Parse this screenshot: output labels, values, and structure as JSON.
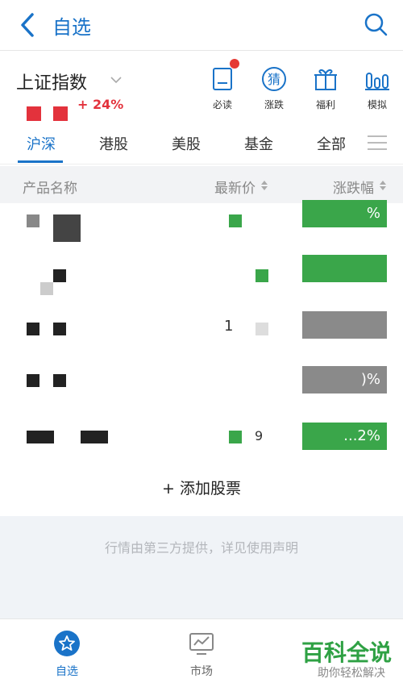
{
  "header": {
    "title": "自选"
  },
  "index": {
    "name": "上证指数",
    "change": "+  24%"
  },
  "shortcuts": [
    {
      "label": "必读",
      "icon": "doc-icon"
    },
    {
      "label": "涨跌",
      "icon": "guess-icon",
      "glyph": "猜"
    },
    {
      "label": "福利",
      "icon": "gift-icon"
    },
    {
      "label": "模拟",
      "icon": "bar-chart-icon"
    }
  ],
  "tabs": [
    "沪深",
    "港股",
    "美股",
    "基金",
    "全部"
  ],
  "columns": {
    "name": "产品名称",
    "price": "最新价",
    "change": "涨跌幅"
  },
  "rows": [
    {
      "price": "",
      "change": "%"
    },
    {
      "price": "",
      "change": ""
    },
    {
      "price": "1",
      "change": ""
    },
    {
      "price": "",
      "change": ")%"
    },
    {
      "price": "9",
      "change": "...2%"
    }
  ],
  "add_stock": "+ 添加股票",
  "disclaimer": "行情由第三方提供，详见使用声明",
  "bottom_nav": [
    {
      "label": "自选",
      "icon": "star-icon"
    },
    {
      "label": "市场",
      "icon": "chart-icon"
    }
  ],
  "watermark": {
    "brand": "百科全说",
    "sub": "助你轻松解决"
  },
  "colors": {
    "accent": "#1a73c8",
    "up": "#e3323c",
    "down": "#3aa64a"
  }
}
